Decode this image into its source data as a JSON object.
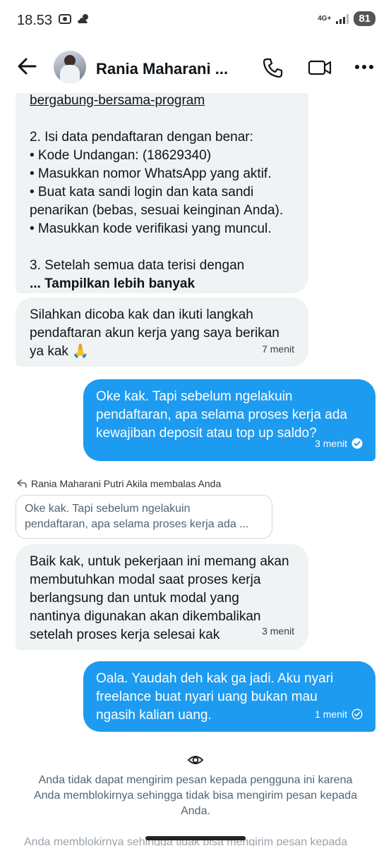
{
  "status": {
    "time": "18.53",
    "network": "4G+",
    "battery": "81"
  },
  "header": {
    "name": "Rania Maharani ..."
  },
  "messages": {
    "m1": {
      "lines": [
        "bergabung-bersama-program",
        "",
        "2. Isi data pendaftaran dengan benar:",
        "• Kode Undangan: (18629340)",
        "• Masukkan nomor WhatsApp yang aktif.",
        "• Buat kata sandi login dan kata sandi",
        "penarikan (bebas, sesuai keinginan Anda).",
        "• Masukkan kode verifikasi yang muncul.",
        "",
        "3. Setelah semua data terisi dengan"
      ],
      "show_more": "... Tampilkan lebih banyak"
    },
    "m2": {
      "lines": [
        "Silahkan dicoba kak dan ikuti langkah",
        "pendaftaran akun kerja yang saya berikan",
        "ya kak 🙏"
      ],
      "time": "7 menit"
    },
    "m3": {
      "lines": [
        "Oke kak. Tapi sebelum ngelakuin",
        "pendaftaran, apa selama proses kerja ada",
        "kewajiban deposit atau top up saldo?"
      ],
      "time": "3 menit"
    },
    "reply_label": "Rania Maharani Putri Akila membalas Anda",
    "quote_lines": [
      "Oke kak. Tapi sebelum ngelakuin",
      "pendaftaran, apa selama proses kerja ada ..."
    ],
    "m4": {
      "lines": [
        "Baik kak, untuk pekerjaan ini memang akan",
        "membutuhkan modal saat proses kerja",
        "berlangsung dan untuk modal yang",
        "nantinya digunakan akan dikembalikan",
        "setelah proses kerja selesai kak"
      ],
      "time": "3 menit"
    },
    "m5": {
      "lines": [
        "Oala. Yaudah deh kak ga jadi. Aku nyari",
        "freelance buat nyari uang bukan mau",
        "ngasih kalian uang."
      ],
      "time": "1 menit"
    }
  },
  "blocked_notice": {
    "lines": [
      "Anda tidak dapat mengirim pesan kepada pengguna ini karena",
      "Anda memblokirnya sehingga tidak bisa mengirim pesan kepada",
      "Anda."
    ],
    "ghost": "Anda memblokirnya sehingga tidak bisa mengirim pesan kepada"
  },
  "colors": {
    "accent": "#1d9bf0",
    "bubble_in": "#eff3f4"
  }
}
